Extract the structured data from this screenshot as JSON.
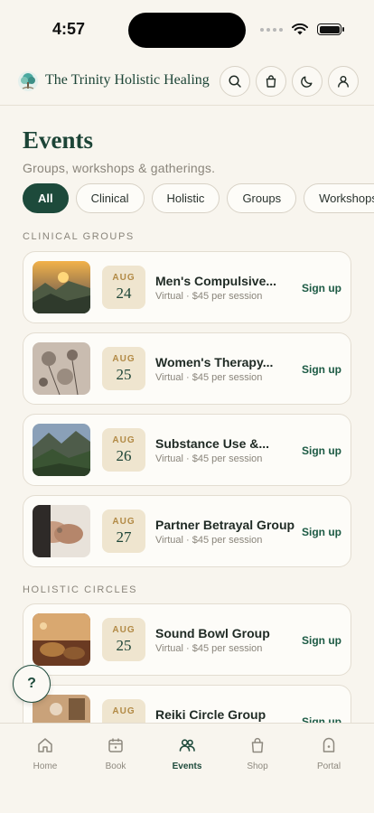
{
  "status_bar": {
    "time": "4:57"
  },
  "header": {
    "brand": "The Trinity Holistic Healing"
  },
  "page": {
    "title": "Events",
    "subtitle": "Groups, workshops & gatherings."
  },
  "filters": [
    "All",
    "Clinical",
    "Holistic",
    "Groups",
    "Workshops"
  ],
  "sections": [
    {
      "label": "CLINICAL GROUPS",
      "events": [
        {
          "month": "AUG",
          "day": "24",
          "title": "Men's Compulsive...",
          "meta": "Virtual · $45 per session",
          "action": "Sign up"
        },
        {
          "month": "AUG",
          "day": "25",
          "title": "Women's Therapy...",
          "meta": "Virtual · $45 per session",
          "action": "Sign up"
        },
        {
          "month": "AUG",
          "day": "26",
          "title": "Substance Use &...",
          "meta": "Virtual · $45 per session",
          "action": "Sign up"
        },
        {
          "month": "AUG",
          "day": "27",
          "title": "Partner Betrayal Group",
          "meta": "Virtual · $45 per session",
          "action": "Sign up"
        }
      ]
    },
    {
      "label": "HOLISTIC CIRCLES",
      "events": [
        {
          "month": "AUG",
          "day": "25",
          "title": "Sound Bowl Group",
          "meta": "Virtual · $45 per session",
          "action": "Sign up"
        },
        {
          "month": "AUG",
          "day": "",
          "title": "Reiki Circle Group",
          "meta": "",
          "action": "Sign up"
        }
      ]
    }
  ],
  "help": {
    "label": "?"
  },
  "tabs": [
    {
      "label": "Home",
      "icon": "home-icon"
    },
    {
      "label": "Book",
      "icon": "calendar-icon"
    },
    {
      "label": "Events",
      "icon": "people-icon"
    },
    {
      "label": "Shop",
      "icon": "bag-icon"
    },
    {
      "label": "Portal",
      "icon": "lock-icon"
    }
  ],
  "colors": {
    "primary": "#1d4a3b",
    "background": "#f8f5ee",
    "badge": "#efe5cf",
    "badge_text": "#b28a45"
  }
}
